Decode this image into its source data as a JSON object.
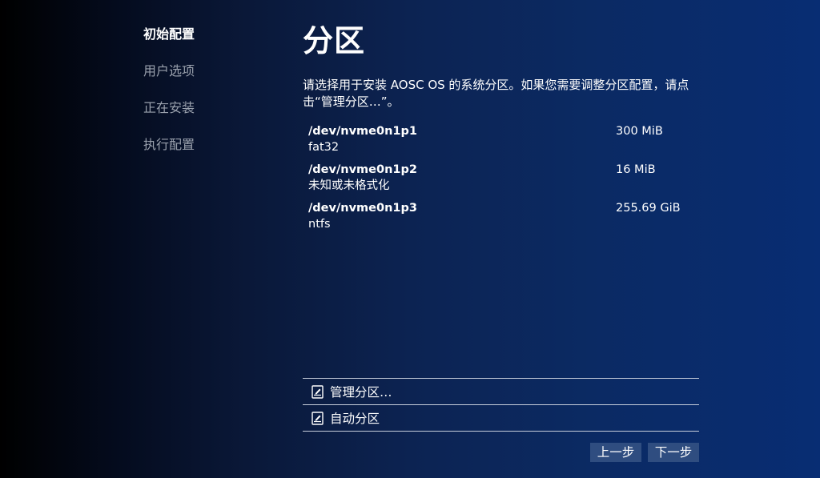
{
  "sidebar": {
    "steps": [
      {
        "label": "初始配置",
        "active": true
      },
      {
        "label": "用户选项",
        "active": false
      },
      {
        "label": "正在安装",
        "active": false
      },
      {
        "label": "执行配置",
        "active": false
      }
    ]
  },
  "main": {
    "title": "分区",
    "description": "请选择用于安装 AOSC OS 的系统分区。如果您需要调整分区配置，请点击“管理分区…”。",
    "partitions": [
      {
        "device": "/dev/nvme0n1p1",
        "filesystem": "fat32",
        "size": "300 MiB"
      },
      {
        "device": "/dev/nvme0n1p2",
        "filesystem": "未知或未格式化",
        "size": "16 MiB"
      },
      {
        "device": "/dev/nvme0n1p3",
        "filesystem": "ntfs",
        "size": "255.69 GiB"
      }
    ],
    "actions": [
      {
        "label": "管理分区…",
        "icon": "disk-edit-icon"
      },
      {
        "label": "自动分区",
        "icon": "disk-edit-icon"
      }
    ],
    "nav": {
      "back_label": "上一步",
      "next_label": "下一步"
    }
  },
  "colors": {
    "active_step": "#ffffff",
    "inactive_step": "#9aa1ad",
    "button_bg": "#2f4d80",
    "divider": "#c8cfdc"
  }
}
